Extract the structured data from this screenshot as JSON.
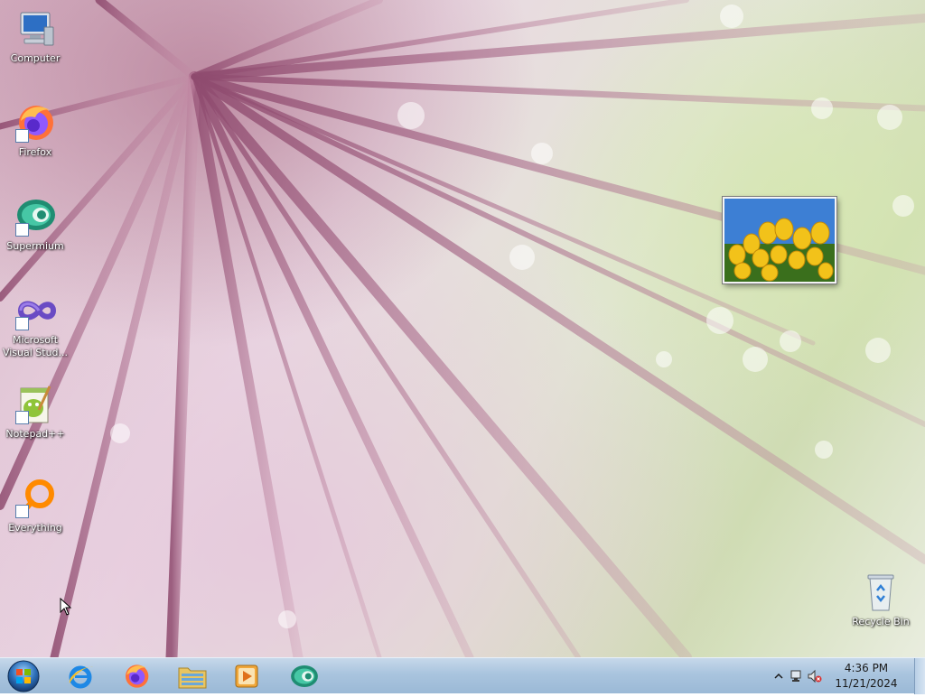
{
  "desktop": {
    "icons": [
      {
        "label": "Computer",
        "icon": "computer-icon",
        "shortcut": false
      },
      {
        "label": "Firefox",
        "icon": "firefox-icon",
        "shortcut": true
      },
      {
        "label": "Supermium",
        "icon": "supermium-icon",
        "shortcut": true
      },
      {
        "label": "Microsoft Visual Stud...",
        "icon": "visual-studio-icon",
        "shortcut": true
      },
      {
        "label": "Notepad++",
        "icon": "notepadpp-icon",
        "shortcut": true
      },
      {
        "label": "Everything",
        "icon": "everything-icon",
        "shortcut": true
      },
      {
        "label": "Recycle Bin",
        "icon": "recycle-bin-icon",
        "shortcut": false
      }
    ],
    "icon_label_1": "Computer",
    "icon_label_2": "Firefox",
    "icon_label_3": "Supermium",
    "icon_label_4_line1": "Microsoft",
    "icon_label_4_line2": "Visual Stud...",
    "icon_label_5": "Notepad++",
    "icon_label_6": "Everything",
    "icon_label_7": "Recycle Bin",
    "gadget": {
      "type": "slideshow-gadget",
      "subject": "yellow tulips"
    }
  },
  "taskbar": {
    "start_button": "windows-start-orb-icon",
    "pinned": [
      {
        "name": "Internet Explorer",
        "icon": "internet-explorer-icon"
      },
      {
        "name": "Firefox",
        "icon": "firefox-icon"
      },
      {
        "name": "Windows Explorer",
        "icon": "file-explorer-icon"
      },
      {
        "name": "Windows Media Player",
        "icon": "media-player-icon"
      },
      {
        "name": "Supermium",
        "icon": "supermium-icon"
      }
    ],
    "tray": {
      "icons": [
        "show-hidden-icons-chevron",
        "network-icon",
        "volume-muted-icon"
      ],
      "time": "4:36 PM",
      "date": "11/21/2024"
    }
  },
  "colors": {
    "taskbar": "#a9c4de",
    "icon_text": "#ffffff",
    "accent_firefox": "#ff7139",
    "accent_supermium": "#2aa58a"
  }
}
